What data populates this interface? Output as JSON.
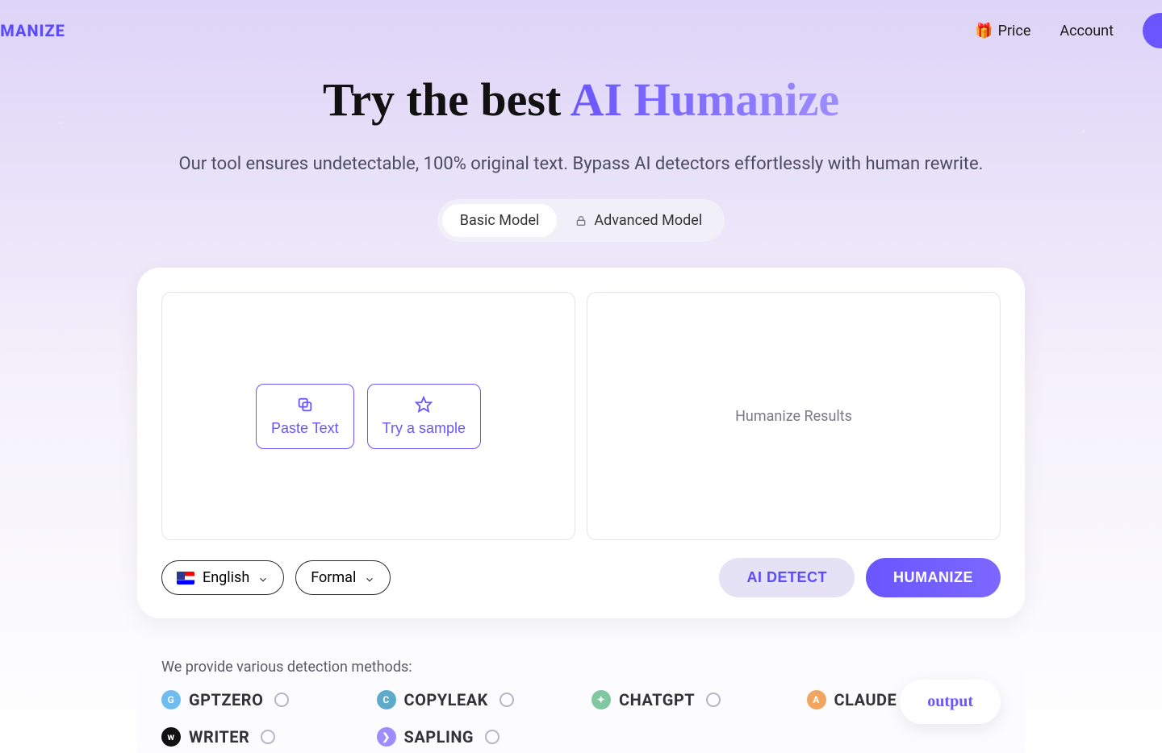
{
  "header": {
    "logo_text": "UMANIZE",
    "price_label": "Price",
    "price_emoji": "🎁",
    "account_label": "Account"
  },
  "hero": {
    "title_plain": "Try the best ",
    "title_gradient": "AI Humanize",
    "subtitle": "Our tool ensures undetectable, 100% original text. Bypass AI detectors effortlessly with human rewrite."
  },
  "model_toggle": {
    "basic": "Basic Model",
    "advanced": "Advanced Model"
  },
  "editor": {
    "paste_label": "Paste Text",
    "sample_label": "Try a sample",
    "results_label": "Humanize Results"
  },
  "selects": {
    "language": "English",
    "tone": "Formal"
  },
  "actions": {
    "detect": "AI DETECT",
    "humanize": "HUMANIZE"
  },
  "detectors": {
    "title": "We provide various detection methods:",
    "items": [
      {
        "name": "GPTZERO"
      },
      {
        "name": "COPYLEAK"
      },
      {
        "name": "CHATGPT"
      },
      {
        "name": "CLAUDE"
      },
      {
        "name": "WRITER"
      },
      {
        "name": "SAPLING"
      }
    ],
    "output_label": "output"
  }
}
